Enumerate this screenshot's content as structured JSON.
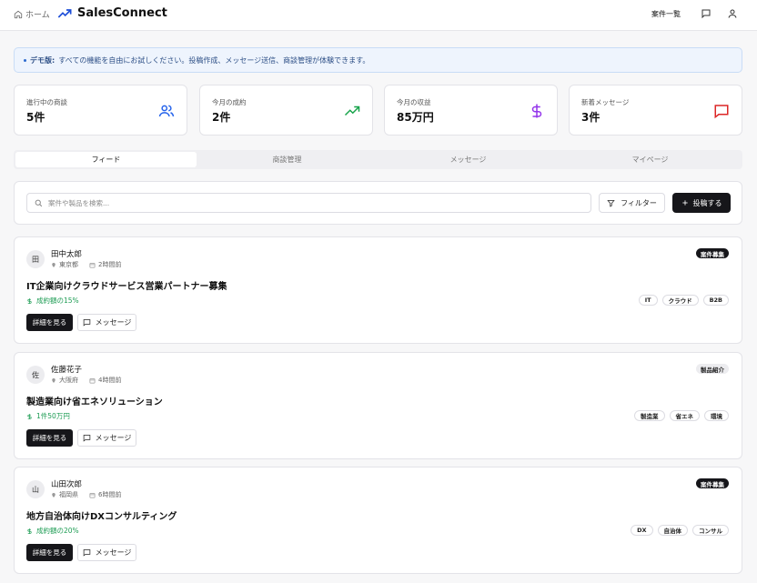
{
  "header": {
    "home_label": "ホーム",
    "brand": "SalesConnect",
    "nav_link": "案件一覧",
    "icons": [
      "home-icon",
      "trending-up-icon",
      "message-icon",
      "user-icon"
    ]
  },
  "banner": {
    "strong": "デモ版:",
    "text": "すべての機能を自由にお試しください。投稿作成、メッセージ送信、商談管理が体験できます。"
  },
  "stats": [
    {
      "label": "進行中の商談",
      "value": "5件",
      "icon": "users-icon",
      "color": "#2563eb"
    },
    {
      "label": "今月の成約",
      "value": "2件",
      "icon": "trending-up-icon",
      "color": "#16a34a"
    },
    {
      "label": "今月の収益",
      "value": "85万円",
      "icon": "dollar-icon",
      "color": "#9333ea"
    },
    {
      "label": "新着メッセージ",
      "value": "3件",
      "icon": "message-icon",
      "color": "#dc2626"
    }
  ],
  "tabs": [
    "フィード",
    "商談管理",
    "メッセージ",
    "マイページ"
  ],
  "search": {
    "placeholder": "案件や製品を検索...",
    "filter_label": "フィルター",
    "post_label": "投稿する"
  },
  "posts": [
    {
      "avatar": "田",
      "author": "田中太郎",
      "location": "東京都",
      "time": "2時間前",
      "badge": "案件募集",
      "badge_style": "dark",
      "title": "IT企業向けクラウドサービス営業パートナー募集",
      "price": "成約額の15%",
      "tags": [
        "IT",
        "クラウド",
        "B2B"
      ],
      "detail_label": "詳細を見る",
      "message_label": "メッセージ"
    },
    {
      "avatar": "佐",
      "author": "佐藤花子",
      "location": "大阪府",
      "time": "4時間前",
      "badge": "製品紹介",
      "badge_style": "light",
      "title": "製造業向け省エネソリューション",
      "price": "1件50万円",
      "tags": [
        "製造業",
        "省エネ",
        "環境"
      ],
      "detail_label": "詳細を見る",
      "message_label": "メッセージ"
    },
    {
      "avatar": "山",
      "author": "山田次郎",
      "location": "福岡県",
      "time": "6時間前",
      "badge": "案件募集",
      "badge_style": "dark",
      "title": "地方自治体向けDXコンサルティング",
      "price": "成約額の20%",
      "tags": [
        "DX",
        "自治体",
        "コンサル"
      ],
      "detail_label": "詳細を見る",
      "message_label": "メッセージ"
    }
  ]
}
